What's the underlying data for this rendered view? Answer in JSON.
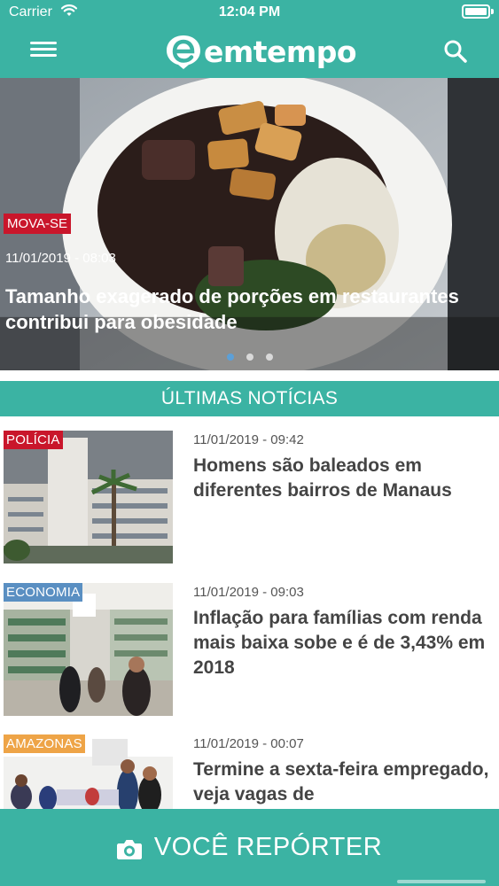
{
  "status_bar": {
    "carrier": "Carrier",
    "time": "12:04 PM",
    "battery_level": 1.0
  },
  "nav": {
    "brand": "emtempo",
    "menu_icon": "hamburger-menu-icon",
    "search_icon": "search-icon",
    "accent_color": "#3bb3a3"
  },
  "featured": {
    "category": "MOVA-SE",
    "category_color": "#c9162b",
    "date": "11/01/2019 -  08:03",
    "title": "Tamanho exagerado de porções em restaurantes contribui para obesidade",
    "carousel_total": 3,
    "carousel_active": 1
  },
  "section": {
    "title": "ÚLTIMAS NOTÍCIAS"
  },
  "news": [
    {
      "category": "POLÍCIA",
      "category_color": "#c9162b",
      "date": "11/01/2019 -  09:42",
      "title": "Homens são baleados em diferentes bairros de Manaus"
    },
    {
      "category": "ECONOMIA",
      "category_color": "#5a8fc2",
      "date": "11/01/2019 -  09:03",
      "title": "Inflação para famílias com renda mais baixa sobe e é de 3,43% em 2018"
    },
    {
      "category": "AMAZONAS",
      "category_color": "#eea447",
      "date": "11/01/2019 -  00:07",
      "title": "Termine a sexta-feira empregado, veja vagas de"
    }
  ],
  "reporter": {
    "label": "VOCÊ REPÓRTER",
    "icon": "camera-icon"
  }
}
